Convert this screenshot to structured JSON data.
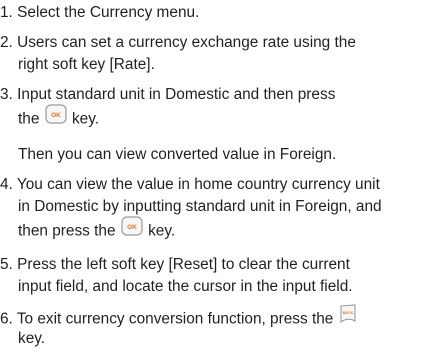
{
  "steps": [
    {
      "num": "1.",
      "line1": "Select the Currency menu."
    },
    {
      "num": "2.",
      "line1": "Users can set a currency exchange rate using the",
      "line2": "right soft key [Rate]."
    },
    {
      "num": "3.",
      "line1": "Input standard unit in Domestic and then press",
      "line2_pre": "the",
      "line2_post": "key.",
      "note": "Then you can view converted value in Foreign."
    },
    {
      "num": "4.",
      "line1": "You can view the value in home country currency unit",
      "line2": "in Domestic by inputting standard unit in Foreign, and",
      "line3_pre": "then press the",
      "line3_post": "key."
    },
    {
      "num": "5.",
      "line1": "Press the left soft key [Reset] to clear the current",
      "line2": "input field, and locate the cursor in the input field."
    },
    {
      "num": "6.",
      "line1": "To exit currency conversion function, press the",
      "line2": "key."
    }
  ],
  "icons": {
    "ok_key": {
      "name": "ok-key-icon",
      "text": "OK",
      "color": "#e07a1f"
    },
    "back_key": {
      "name": "back-key-icon",
      "text": "BACK",
      "color": "#e07a1f"
    }
  },
  "colors": {
    "text": "#231f20"
  }
}
